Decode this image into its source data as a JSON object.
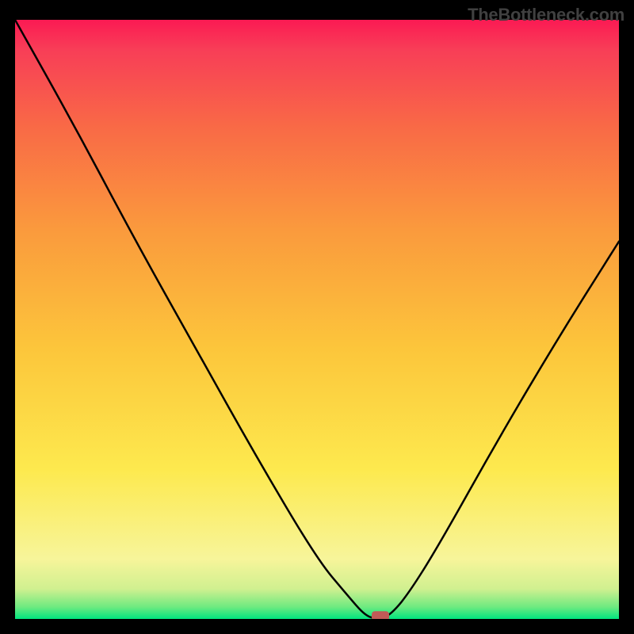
{
  "watermark": "TheBottleneck.com",
  "chart_data": {
    "type": "line",
    "title": "",
    "xlabel": "",
    "ylabel": "",
    "xlim": [
      0,
      100
    ],
    "ylim": [
      0,
      100
    ],
    "series": [
      {
        "name": "bottleneck-curve",
        "x": [
          0,
          10,
          20,
          30,
          40,
          50,
          55,
          58,
          60,
          62,
          65,
          70,
          80,
          90,
          100
        ],
        "y": [
          100,
          82,
          63,
          45,
          27,
          10,
          4,
          0.5,
          0,
          0.5,
          4,
          12,
          30,
          47,
          63
        ]
      }
    ],
    "marker": {
      "x": 60.5,
      "y": 0.5
    },
    "gradient_stops": [
      {
        "offset": 0,
        "color": "#00e57f"
      },
      {
        "offset": 0.02,
        "color": "#6eea80"
      },
      {
        "offset": 0.05,
        "color": "#d0f090"
      },
      {
        "offset": 0.1,
        "color": "#f7f59a"
      },
      {
        "offset": 0.25,
        "color": "#fde94e"
      },
      {
        "offset": 0.45,
        "color": "#fcc63b"
      },
      {
        "offset": 0.65,
        "color": "#fa9a3d"
      },
      {
        "offset": 0.82,
        "color": "#f96a46"
      },
      {
        "offset": 0.95,
        "color": "#f83e57"
      },
      {
        "offset": 1.0,
        "color": "#fb1a53"
      }
    ]
  }
}
